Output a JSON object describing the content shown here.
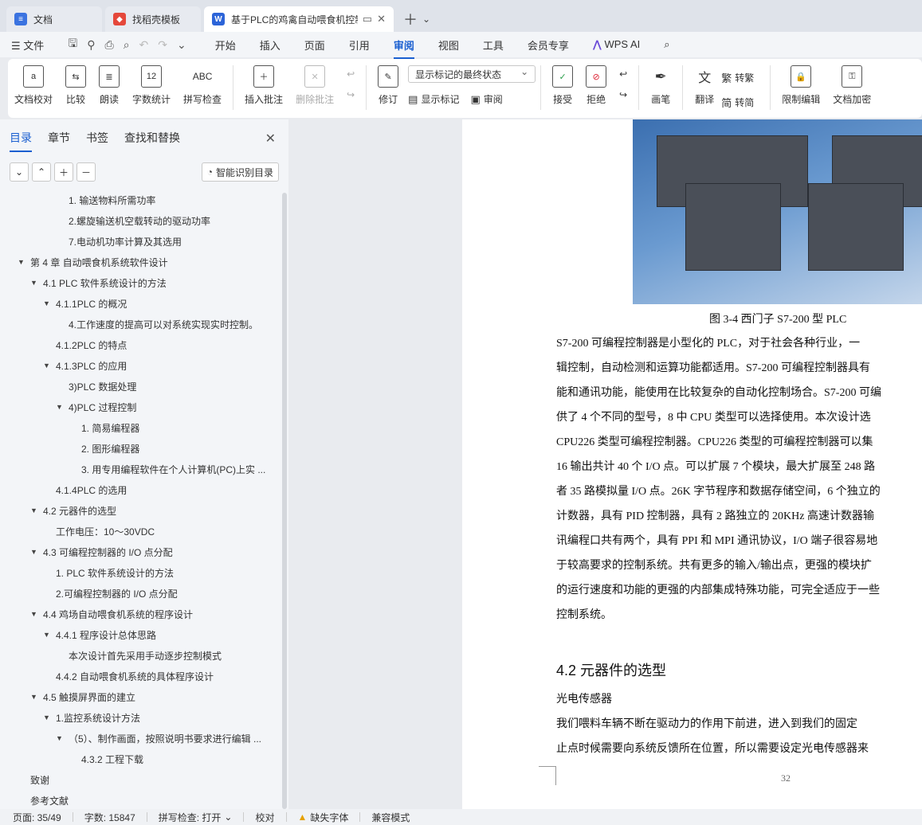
{
  "tabs": [
    {
      "label": "文档",
      "icon": "docs-icon",
      "color": "#3b73e0"
    },
    {
      "label": "找稻壳模板",
      "icon": "docer-icon",
      "color": "#e5483b"
    },
    {
      "label": "基于PLC的鸡禽自动喂食机控制",
      "icon": "wps-writer-icon",
      "color": "#2c64d8"
    }
  ],
  "menu": {
    "file": "文件",
    "items": [
      "开始",
      "插入",
      "页面",
      "引用",
      "审阅",
      "视图",
      "工具",
      "会员专享"
    ],
    "active": "审阅",
    "wps_ai": "WPS AI"
  },
  "ribbon": {
    "doc_check": "文档校对",
    "compare": "比较",
    "read_aloud": "朗读",
    "word_count": "字数统计",
    "word_count_icon": "12",
    "spell_check": "拼写检查",
    "spell_icon": "ABC",
    "insert_comment": "插入批注",
    "delete_comment": "删除批注",
    "revise": "修订",
    "markup_select": "显示标记的最终状态",
    "show_markup": "显示标记",
    "review": "审阅",
    "accept": "接受",
    "reject": "拒绝",
    "pen": "画笔",
    "translate": "翻译",
    "to_trad": "转繁",
    "to_simp": "转简",
    "restrict": "限制编辑",
    "encrypt": "文档加密"
  },
  "nav": {
    "tabs": [
      "目录",
      "章节",
      "书签",
      "查找和替换"
    ],
    "smart_toc": "智能识别目录",
    "toc": [
      {
        "label": "1. 输送物料所需功率",
        "indent": 3,
        "arrow": ""
      },
      {
        "label": "2.螺旋输送机空载转动的驱动功率",
        "indent": 3,
        "arrow": ""
      },
      {
        "label": "7.电动机功率计算及其选用",
        "indent": 3,
        "arrow": ""
      },
      {
        "label": "第 4 章  自动喂食机系统软件设计",
        "indent": 0,
        "arrow": "▼"
      },
      {
        "label": "4.1 PLC 软件系统设计的方法",
        "indent": 1,
        "arrow": "▼"
      },
      {
        "label": "4.1.1PLC 的概况",
        "indent": 2,
        "arrow": "▼"
      },
      {
        "label": "4.工作速度的提高可以对系统实现实时控制。",
        "indent": 3,
        "arrow": ""
      },
      {
        "label": "4.1.2PLC 的特点",
        "indent": 2,
        "arrow": ""
      },
      {
        "label": "4.1.3PLC 的应用",
        "indent": 2,
        "arrow": "▼"
      },
      {
        "label": "3)PLC 数据处理",
        "indent": 3,
        "arrow": ""
      },
      {
        "label": "4)PLC 过程控制",
        "indent": 3,
        "arrow": "▼"
      },
      {
        "label": "1. 简易编程器",
        "indent": 4,
        "arrow": ""
      },
      {
        "label": "2. 图形编程器",
        "indent": 4,
        "arrow": ""
      },
      {
        "label": "3. 用专用编程软件在个人计算机(PC)上实 ...",
        "indent": 4,
        "arrow": ""
      },
      {
        "label": "4.1.4PLC 的选用",
        "indent": 2,
        "arrow": ""
      },
      {
        "label": "4.2  元器件的选型",
        "indent": 1,
        "arrow": "▼"
      },
      {
        "label": "工作电压：10～30VDC",
        "indent": 2,
        "arrow": ""
      },
      {
        "label": "4.3 可编程控制器的 I/O 点分配",
        "indent": 1,
        "arrow": "▼"
      },
      {
        "label": "1. PLC 软件系统设计的方法",
        "indent": 2,
        "arrow": ""
      },
      {
        "label": "2.可编程控制器的 I/O 点分配",
        "indent": 2,
        "arrow": ""
      },
      {
        "label": "4.4 鸡场自动喂食机系统的程序设计",
        "indent": 1,
        "arrow": "▼"
      },
      {
        "label": "4.4.1 程序设计总体思路",
        "indent": 2,
        "arrow": "▼"
      },
      {
        "label": "本次设计首先采用手动逐步控制模式",
        "indent": 3,
        "arrow": ""
      },
      {
        "label": "4.4.2 自动喂食机系统的具体程序设计",
        "indent": 2,
        "arrow": ""
      },
      {
        "label": "4.5 触摸屏界面的建立",
        "indent": 1,
        "arrow": "▼"
      },
      {
        "label": "1.监控系统设计方法",
        "indent": 2,
        "arrow": "▼"
      },
      {
        "label": "（5）、制作画面，按照说明书要求进行编辑 ...",
        "indent": 3,
        "arrow": "▼"
      },
      {
        "label": "4.3.2  工程下载",
        "indent": 4,
        "arrow": ""
      },
      {
        "label": "致谢",
        "indent": 0,
        "arrow": ""
      },
      {
        "label": "参考文献",
        "indent": 0,
        "arrow": ""
      }
    ]
  },
  "document": {
    "figure_caption": "图 3-4  西门子 S7-200 型 PLC",
    "paragraph_lines": [
      "    S7-200 可编程控制器是小型化的 PLC，对于社会各种行业，一",
      "辑控制，自动检测和运算功能都适用。S7-200 可编程控制器具有",
      "能和通讯功能，能使用在比较复杂的自动化控制场合。S7-200 可编",
      "供了 4 个不同的型号，8 中 CPU 类型可以选择使用。本次设计选",
      "CPU226 类型可编程控制器。CPU226 类型的可编程控制器可以集",
      "16 输出共计 40 个 I/O 点。可以扩展 7 个模块，最大扩展至 248 路",
      "者 35 路模拟量 I/O 点。26K 字节程序和数据存储空间，6 个独立的",
      "计数器，具有 PID 控制器，具有 2 路独立的 20KHz 高速计数器输",
      "讯编程口共有两个，具有 PPI 和 MPI 通讯协议，I/O 端子很容易地",
      "于较高要求的控制系统。共有更多的输入/输出点，更强的模块扩",
      "的运行速度和功能的更强的内部集成特殊功能，可完全适应于一些",
      "控制系统。"
    ],
    "heading": "4.2  元器件的选型",
    "subheading": "    光电传感器",
    "para2_lines": [
      "    我们喂料车辆不断在驱动力的作用下前进，进入到我们的固定",
      "止点时候需要向系统反馈所在位置，所以需要设定光电传感器来"
    ],
    "page_number": "32"
  },
  "status": {
    "page": "页面: 35/49",
    "words": "字数: 15847",
    "spell": "拼写检查: 打开",
    "proof": "校对",
    "missing_font": "缺失字体",
    "compat": "兼容模式"
  }
}
